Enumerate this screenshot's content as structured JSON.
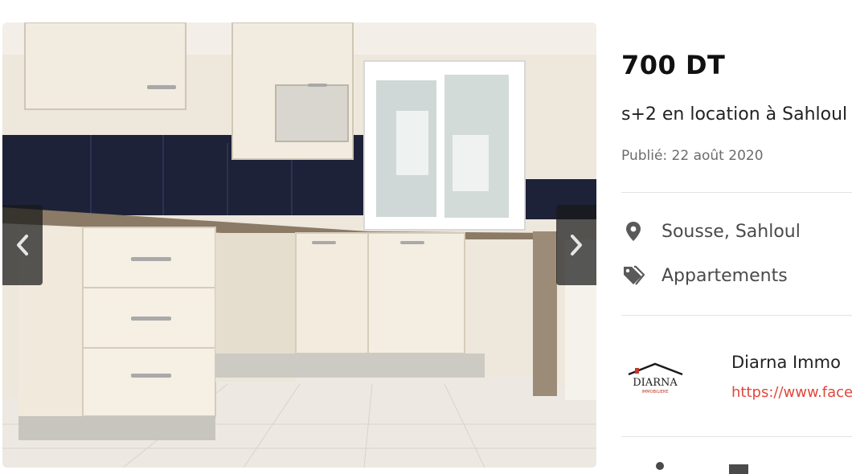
{
  "listing": {
    "price": "700 DT",
    "title": "s+2 en location à Sahloul",
    "published": "Publié: 22 août 2020"
  },
  "details": {
    "location": "Sousse, Sahloul",
    "category": "Appartements"
  },
  "agency": {
    "name": "Diarna Immo",
    "link": "https://www.face",
    "logo_text": "DIARNA",
    "logo_subtext": "IMMOBILIERE"
  },
  "gallery": {
    "photo_alt": "Kitchen with white cabinets, granite countertop and navy tiles"
  },
  "icons": {
    "prev": "chevron-left-icon",
    "next": "chevron-right-icon",
    "location": "map-pin-icon",
    "category": "tag-icon"
  },
  "colors": {
    "link": "#e0473c",
    "price": "#111111",
    "nav_bg": "#191919"
  }
}
